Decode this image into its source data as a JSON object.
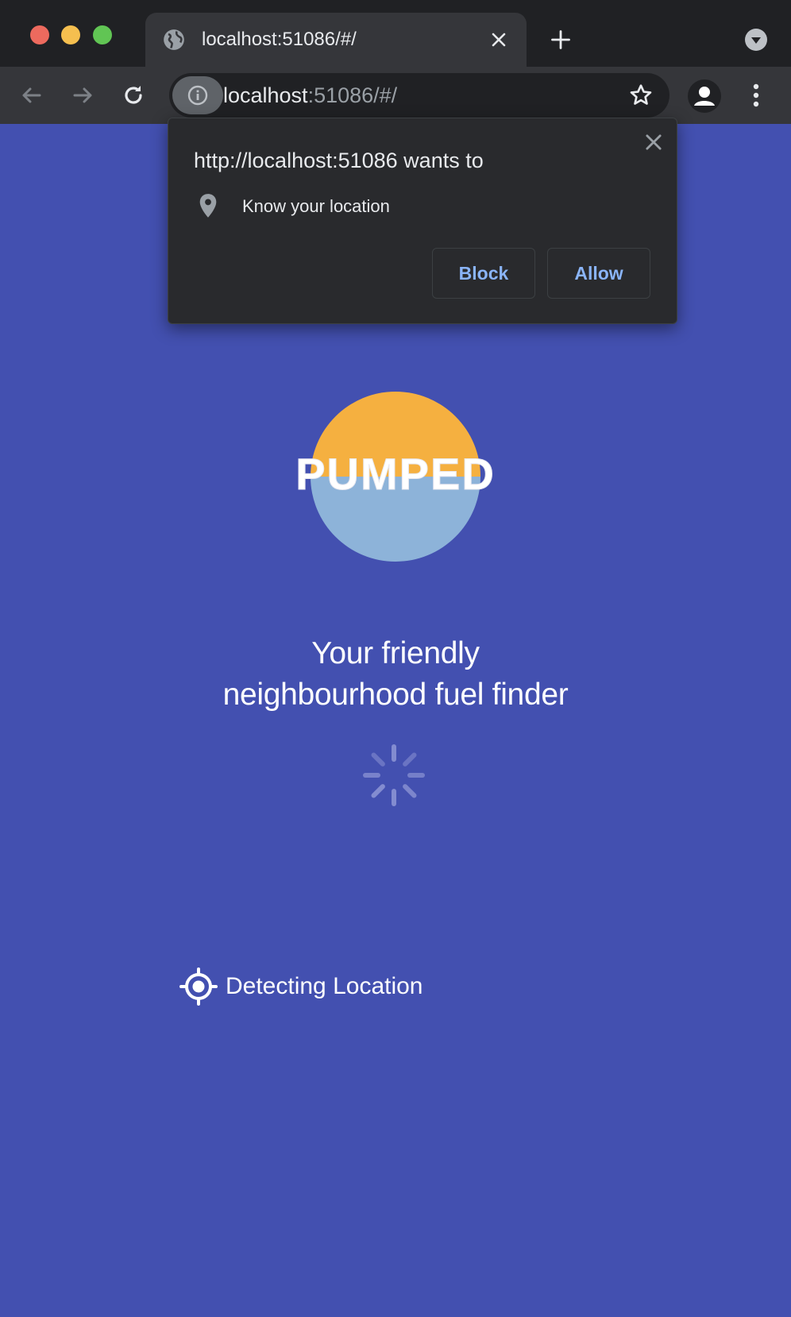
{
  "browser": {
    "tab_title": "localhost:51086/#/",
    "url_host": "localhost",
    "url_rest": ":51086/#/"
  },
  "permission_popup": {
    "title": "http://localhost:51086 wants to",
    "permission": "Know your location",
    "block_label": "Block",
    "allow_label": "Allow"
  },
  "app": {
    "logo_text": "PUMPED",
    "tagline_line1": "Your friendly",
    "tagline_line2": "neighbourhood fuel finder",
    "status_text": "Detecting Location"
  },
  "colors": {
    "background": "#4350b0",
    "logo_top": "#f5b040",
    "logo_bottom": "#8db3d9",
    "link_blue": "#8ab4f8"
  },
  "icons": [
    "globe-icon",
    "close-icon",
    "plus-icon",
    "chevron-down-icon",
    "back-arrow-icon",
    "forward-arrow-icon",
    "reload-icon",
    "info-icon",
    "star-icon",
    "profile-icon",
    "more-vert-icon",
    "location-pin-icon",
    "spinner-icon",
    "target-icon"
  ]
}
